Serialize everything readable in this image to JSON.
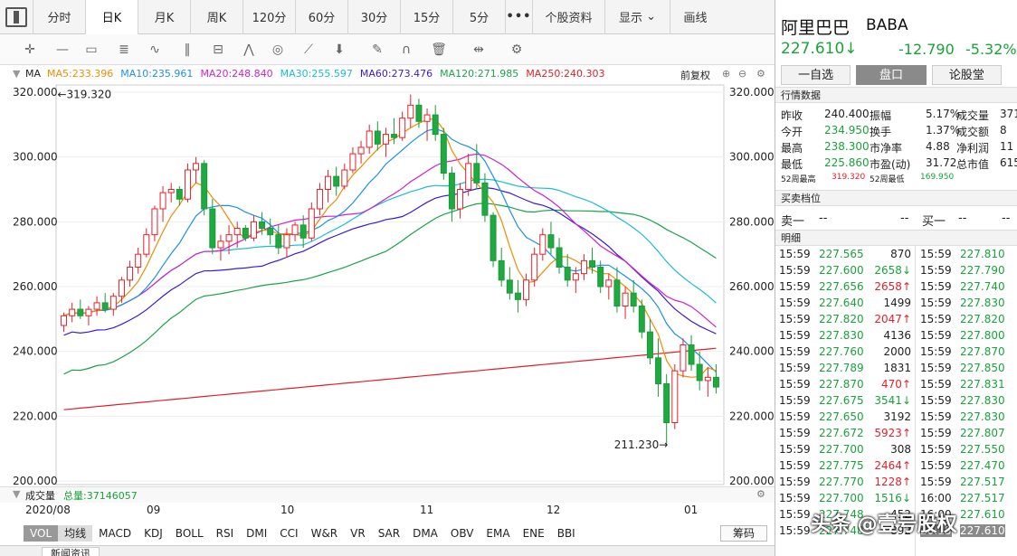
{
  "tabs": [
    "分时",
    "日K",
    "月K",
    "周K",
    "120分",
    "60分",
    "30分",
    "15分",
    "5分",
    "•••",
    "个股资料"
  ],
  "active_tab": "日K",
  "display_label": "显示",
  "draw_label": "画线",
  "ma_row": {
    "label": "MA",
    "items": [
      {
        "text": "MA5:233.396",
        "color": "#f08c00"
      },
      {
        "text": "MA10:235.961",
        "color": "#1e8fe6"
      },
      {
        "text": "MA20:248.840",
        "color": "#d01ed0"
      },
      {
        "text": "MA30:255.597",
        "color": "#19bcd6"
      },
      {
        "text": "MA60:273.476",
        "color": "#3a1ad6"
      },
      {
        "text": "MA120:271.985",
        "color": "#1aa34a"
      },
      {
        "text": "MA250:240.303",
        "color": "#e01e28"
      }
    ],
    "adjust": "前复权"
  },
  "chart_data": {
    "type": "candlestick",
    "y_ticks": [
      "320.000",
      "300.000",
      "280.000",
      "260.000",
      "240.000",
      "220.000",
      "200.000"
    ],
    "ylim": [
      200,
      320
    ],
    "x_labels": [
      "2020/08",
      "09",
      "10",
      "11",
      "12",
      "01"
    ],
    "annotations": [
      {
        "text": "←319.320",
        "value": 319.32
      },
      {
        "text": "211.230→",
        "value": 211.23
      }
    ],
    "candles": [
      [
        248,
        252,
        246,
        251
      ],
      [
        251,
        255,
        249,
        253
      ],
      [
        253,
        256,
        250,
        251
      ],
      [
        251,
        254,
        248,
        253
      ],
      [
        253,
        257,
        251,
        255
      ],
      [
        255,
        258,
        252,
        253
      ],
      [
        253,
        258,
        251,
        257
      ],
      [
        257,
        263,
        255,
        262
      ],
      [
        262,
        268,
        260,
        266
      ],
      [
        266,
        272,
        264,
        270
      ],
      [
        270,
        278,
        269,
        276
      ],
      [
        276,
        285,
        274,
        284
      ],
      [
        284,
        291,
        280,
        289
      ],
      [
        289,
        292,
        286,
        290
      ],
      [
        290,
        291,
        285,
        287
      ],
      [
        287,
        298,
        286,
        296
      ],
      [
        296,
        300,
        292,
        298
      ],
      [
        298,
        299,
        282,
        284
      ],
      [
        284,
        287,
        270,
        272
      ],
      [
        272,
        276,
        268,
        274
      ],
      [
        274,
        279,
        270,
        276
      ],
      [
        276,
        280,
        272,
        278
      ],
      [
        278,
        279,
        274,
        275
      ],
      [
        275,
        282,
        274,
        280
      ],
      [
        280,
        283,
        276,
        278
      ],
      [
        278,
        281,
        273,
        276
      ],
      [
        276,
        279,
        270,
        272
      ],
      [
        272,
        278,
        269,
        276
      ],
      [
        276,
        280,
        274,
        279
      ],
      [
        279,
        282,
        272,
        275
      ],
      [
        275,
        286,
        274,
        284
      ],
      [
        284,
        292,
        282,
        290
      ],
      [
        290,
        296,
        286,
        294
      ],
      [
        294,
        297,
        288,
        291
      ],
      [
        291,
        298,
        290,
        296
      ],
      [
        296,
        303,
        295,
        301
      ],
      [
        301,
        305,
        298,
        303
      ],
      [
        303,
        310,
        301,
        308
      ],
      [
        308,
        311,
        302,
        304
      ],
      [
        304,
        309,
        300,
        307
      ],
      [
        307,
        312,
        304,
        306
      ],
      [
        306,
        314,
        305,
        312
      ],
      [
        312,
        319.3,
        309,
        316
      ],
      [
        316,
        318,
        309,
        311
      ],
      [
        311,
        315,
        305,
        313
      ],
      [
        313,
        316,
        305,
        307
      ],
      [
        307,
        309,
        293,
        295
      ],
      [
        295,
        297,
        280,
        284
      ],
      [
        284,
        292,
        281,
        290
      ],
      [
        290,
        301,
        288,
        298
      ],
      [
        298,
        304,
        290,
        292
      ],
      [
        292,
        295,
        280,
        282
      ],
      [
        282,
        283,
        266,
        268
      ],
      [
        268,
        272,
        260,
        262
      ],
      [
        262,
        266,
        256,
        258
      ],
      [
        258,
        262,
        252,
        256
      ],
      [
        256,
        264,
        254,
        262
      ],
      [
        262,
        272,
        260,
        270
      ],
      [
        270,
        278,
        268,
        276
      ],
      [
        276,
        280,
        270,
        272
      ],
      [
        272,
        275,
        264,
        266
      ],
      [
        266,
        270,
        260,
        262
      ],
      [
        262,
        266,
        258,
        264
      ],
      [
        264,
        270,
        262,
        268
      ],
      [
        268,
        272,
        264,
        266
      ],
      [
        266,
        268,
        258,
        260
      ],
      [
        260,
        264,
        256,
        262
      ],
      [
        262,
        266,
        252,
        254
      ],
      [
        254,
        260,
        250,
        258
      ],
      [
        258,
        262,
        252,
        254
      ],
      [
        254,
        256,
        244,
        246
      ],
      [
        246,
        250,
        236,
        238
      ],
      [
        238,
        244,
        226,
        230
      ],
      [
        230,
        233,
        211.23,
        218
      ],
      [
        218,
        236,
        216,
        234
      ],
      [
        234,
        244,
        232,
        242
      ],
      [
        242,
        245,
        234,
        236
      ],
      [
        236,
        240,
        228,
        231
      ],
      [
        231,
        235,
        226,
        232
      ],
      [
        232,
        236,
        227,
        229
      ]
    ]
  },
  "volume": {
    "label": "成交量",
    "total": "总量:37146057"
  },
  "indicators": [
    "VOL",
    "均线",
    "MACD",
    "KDJ",
    "BOLL",
    "RSI",
    "DMI",
    "CCI",
    "W&R",
    "VR",
    "SAR",
    "DMA",
    "OBV",
    "EMA",
    "ENE",
    "BBI"
  ],
  "active_indicator": "VOL",
  "chouma": "筹码",
  "news_tab": "新闻资讯",
  "stock": {
    "name": "阿里巴巴",
    "ticker": "BABA",
    "price": "227.610↓",
    "change": "-12.790",
    "change_pct": "-5.32%"
  },
  "right_tabs": [
    "一自选",
    "盘口",
    "论股堂"
  ],
  "active_right_tab": "盘口",
  "quote_section": "行情数据",
  "quote_rows": [
    [
      {
        "t": "昨收"
      },
      {
        "t": "240.400",
        "c": "#222"
      },
      {
        "t": "振幅"
      },
      {
        "t": "5.17%"
      },
      {
        "t": "成交量"
      },
      {
        "t": "371"
      }
    ],
    [
      {
        "t": "今开"
      },
      {
        "t": "234.950",
        "c": "#19a33a"
      },
      {
        "t": "换手"
      },
      {
        "t": "1.37%"
      },
      {
        "t": "成交额"
      },
      {
        "t": "8"
      }
    ],
    [
      {
        "t": "最高"
      },
      {
        "t": "238.300",
        "c": "#19a33a"
      },
      {
        "t": "市净率"
      },
      {
        "t": "4.88"
      },
      {
        "t": "净利润"
      },
      {
        "t": "11"
      }
    ],
    [
      {
        "t": "最低"
      },
      {
        "t": "225.860",
        "c": "#19a33a"
      },
      {
        "t": "市盈(动)"
      },
      {
        "t": "31.72"
      },
      {
        "t": "总市值"
      },
      {
        "t": "615"
      }
    ]
  ],
  "w52": {
    "high_label": "52周最高",
    "high": "319.320",
    "low_label": "52周最低",
    "low": "169.950"
  },
  "bidask_section": "买卖档位",
  "sell1": {
    "label": "卖一",
    "v1": "--",
    "v2": "--"
  },
  "buy1": {
    "label": "买一",
    "v1": "--",
    "v2": "--"
  },
  "detail_section": "明细",
  "trades_left": [
    {
      "time": "15:59",
      "price": "227.565",
      "vol": "870",
      "arrow": ""
    },
    {
      "time": "15:59",
      "price": "227.600",
      "vol": "2658↓",
      "arrow": "down"
    },
    {
      "time": "15:59",
      "price": "227.656",
      "vol": "2658↑",
      "arrow": "up"
    },
    {
      "time": "15:59",
      "price": "227.640",
      "vol": "1499",
      "arrow": ""
    },
    {
      "time": "15:59",
      "price": "227.820",
      "vol": "2047↑",
      "arrow": "up"
    },
    {
      "time": "15:59",
      "price": "227.830",
      "vol": "4136",
      "arrow": ""
    },
    {
      "time": "15:59",
      "price": "227.760",
      "vol": "2000",
      "arrow": ""
    },
    {
      "time": "15:59",
      "price": "227.789",
      "vol": "1831",
      "arrow": ""
    },
    {
      "time": "15:59",
      "price": "227.870",
      "vol": "470↑",
      "arrow": "up"
    },
    {
      "time": "15:59",
      "price": "227.675",
      "vol": "3541↓",
      "arrow": "down"
    },
    {
      "time": "15:59",
      "price": "227.650",
      "vol": "3192",
      "arrow": ""
    },
    {
      "time": "15:59",
      "price": "227.672",
      "vol": "5923↑",
      "arrow": "up"
    },
    {
      "time": "15:59",
      "price": "227.700",
      "vol": "308",
      "arrow": ""
    },
    {
      "time": "15:59",
      "price": "227.775",
      "vol": "2464↑",
      "arrow": "up"
    },
    {
      "time": "15:59",
      "price": "227.770",
      "vol": "1228↑",
      "arrow": "up"
    },
    {
      "time": "15:59",
      "price": "227.700",
      "vol": "1516↓",
      "arrow": "down"
    },
    {
      "time": "15:59",
      "price": "227.748",
      "vol": "452",
      "arrow": ""
    },
    {
      "time": "15:59",
      "price": "227.748",
      "vol": "892",
      "arrow": ""
    }
  ],
  "trades_right": [
    {
      "time": "15:59",
      "price": "227.810"
    },
    {
      "time": "15:59",
      "price": "227.790"
    },
    {
      "time": "15:59",
      "price": "227.740"
    },
    {
      "time": "15:59",
      "price": "227.830"
    },
    {
      "time": "15:59",
      "price": "227.820"
    },
    {
      "time": "15:59",
      "price": "227.800"
    },
    {
      "time": "15:59",
      "price": "227.870"
    },
    {
      "time": "15:59",
      "price": "227.850"
    },
    {
      "time": "15:59",
      "price": "227.831"
    },
    {
      "time": "15:59",
      "price": "227.830"
    },
    {
      "time": "15:59",
      "price": "227.830"
    },
    {
      "time": "15:59",
      "price": "227.807"
    },
    {
      "time": "15:59",
      "price": "227.550"
    },
    {
      "time": "15:59",
      "price": "227.470"
    },
    {
      "time": "15:59",
      "price": "227.517"
    },
    {
      "time": "16:00",
      "price": "227.517"
    },
    {
      "time": "16:00",
      "price": "227.610"
    },
    {
      "time": "20:15",
      "price": "227.610"
    }
  ],
  "watermark": "头条 @壹号股权"
}
